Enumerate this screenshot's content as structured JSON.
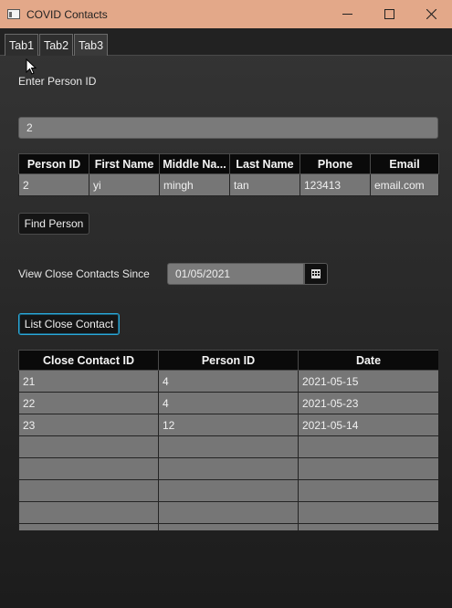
{
  "window": {
    "title": "COVID Contacts"
  },
  "tabs": [
    {
      "label": "Tab1"
    },
    {
      "label": "Tab2"
    },
    {
      "label": "Tab3"
    }
  ],
  "person_search": {
    "prompt_label": "Enter Person ID",
    "person_id_value": "2",
    "find_button_label": "Find Person"
  },
  "person_table": {
    "columns": [
      "Person ID",
      "First Name",
      "Middle Na...",
      "Last Name",
      "Phone",
      "Email"
    ],
    "rows": [
      [
        "2",
        "yi",
        "mingh",
        "tan",
        "123413",
        "email.com"
      ]
    ]
  },
  "close_contacts": {
    "since_label": "View Close Contacts Since",
    "since_date": "01/05/2021",
    "list_button_label": "List Close Contact",
    "columns": [
      "Close Contact ID",
      "Person ID",
      "Date"
    ],
    "rows": [
      [
        "21",
        "4",
        "2021-05-15"
      ],
      [
        "22",
        "4",
        "2021-05-23"
      ],
      [
        "23",
        "12",
        "2021-05-14"
      ]
    ]
  },
  "colors": {
    "titlebar": "#e3a889",
    "focus_accent": "#2aa8d8",
    "table_header": "#0a0a0a",
    "table_cell": "#767676"
  }
}
